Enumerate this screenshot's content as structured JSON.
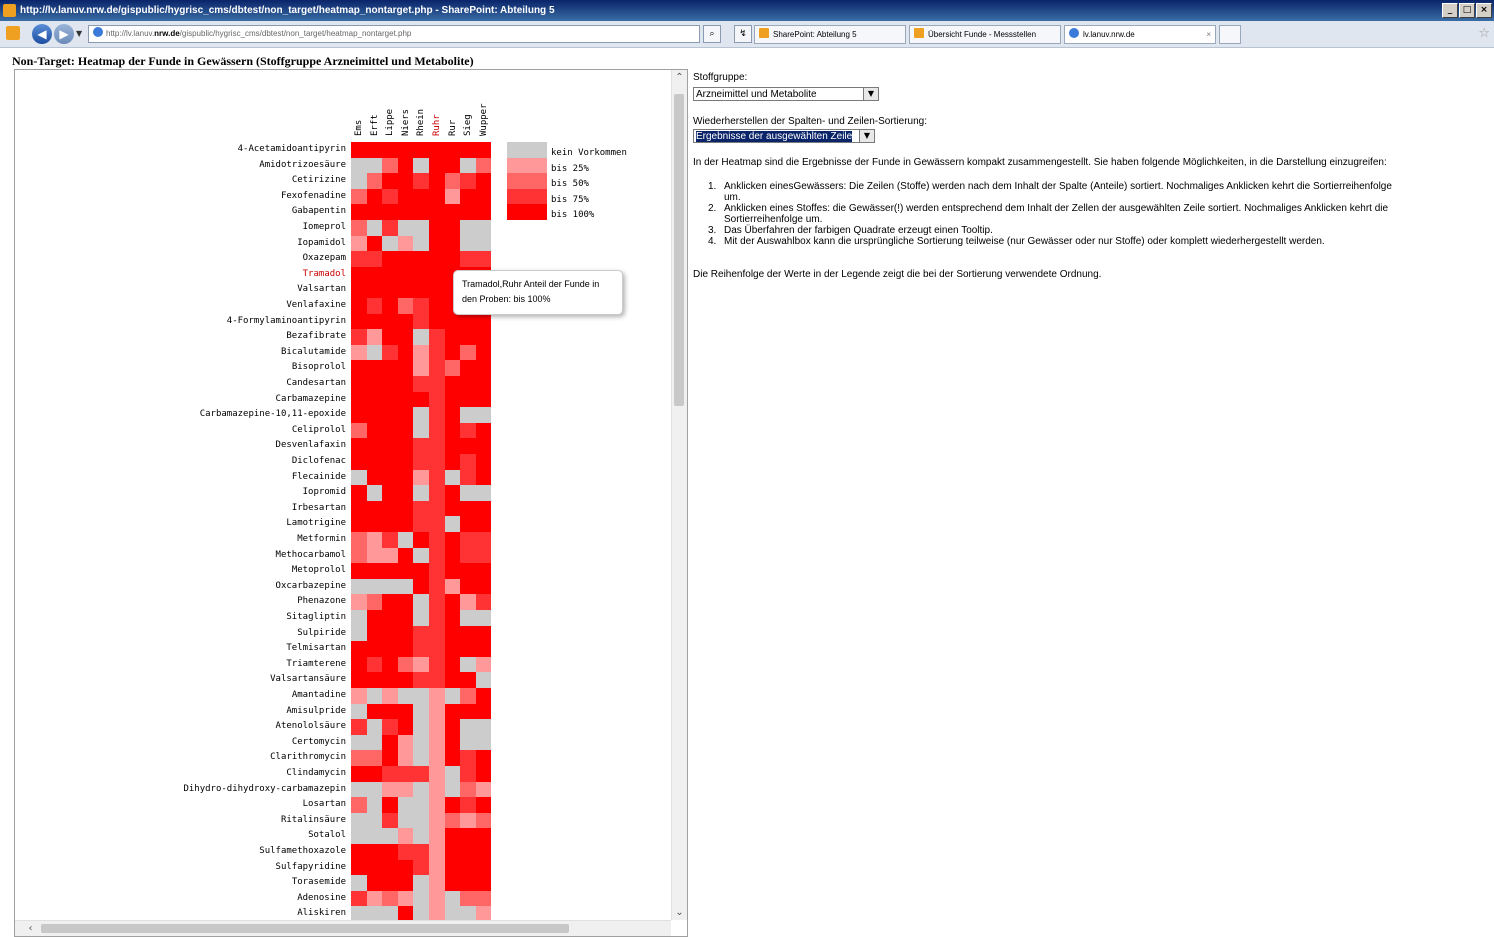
{
  "window": {
    "title": "http://lv.lanuv.nrw.de/gispublic/hygrisc_cms/dbtest/non_target/heatmap_nontarget.php - SharePoint: Abteilung 5"
  },
  "browser": {
    "address_prefix": "http://lv.lanuv.",
    "address_domain": "nrw.de",
    "address_path": "/gispublic/hygrisc_cms/dbtest/non_target/heatmap_nontarget.php",
    "tabs": [
      {
        "label": "SharePoint: Abteilung 5"
      },
      {
        "label": "Übersicht Funde - Messstellen"
      },
      {
        "label": "lv.lanuv.nrw.de"
      }
    ]
  },
  "page": {
    "title": "Non-Target: Heatmap der Funde in Gewässern (Stoffgruppe Arzneimittel und Metabolite)"
  },
  "heatmap": {
    "columns": [
      "Ems",
      "Erft",
      "Lippe",
      "Niers",
      "Rhein",
      "Ruhr",
      "Rur",
      "Sieg",
      "Wupper"
    ],
    "highlight_column": 5,
    "highlight_row": 8,
    "colors": [
      "#cccccc",
      "#ff9999",
      "#ff6666",
      "#ff3333",
      "#ff0000"
    ],
    "legend": [
      "kein Vorkommen",
      "bis 25%",
      "bis 50%",
      "bis 75%",
      "bis 100%"
    ],
    "rows": [
      {
        "name": "4-Acetamidoantipyrin",
        "v": [
          4,
          4,
          4,
          4,
          4,
          4,
          4,
          4,
          4
        ]
      },
      {
        "name": "Amidotrizoesäure",
        "v": [
          0,
          0,
          2,
          4,
          0,
          4,
          4,
          0,
          2
        ]
      },
      {
        "name": "Cetirizine",
        "v": [
          0,
          2,
          4,
          4,
          3,
          4,
          2,
          3,
          4
        ]
      },
      {
        "name": "Fexofenadine",
        "v": [
          2,
          4,
          3,
          4,
          4,
          4,
          1,
          4,
          4
        ]
      },
      {
        "name": "Gabapentin",
        "v": [
          4,
          4,
          4,
          4,
          4,
          4,
          4,
          4,
          4
        ]
      },
      {
        "name": "Iomeprol",
        "v": [
          2,
          0,
          3,
          0,
          0,
          4,
          4,
          0,
          0
        ]
      },
      {
        "name": "Iopamidol",
        "v": [
          1,
          4,
          0,
          1,
          0,
          4,
          4,
          0,
          0
        ]
      },
      {
        "name": "Oxazepam",
        "v": [
          3,
          3,
          4,
          4,
          4,
          4,
          4,
          3,
          3
        ]
      },
      {
        "name": "Tramadol",
        "v": [
          4,
          4,
          4,
          4,
          4,
          4,
          4,
          4,
          4
        ]
      },
      {
        "name": "Valsartan",
        "v": [
          4,
          4,
          4,
          4,
          4,
          4,
          4,
          4,
          4
        ]
      },
      {
        "name": "Venlafaxine",
        "v": [
          4,
          3,
          4,
          2,
          3,
          4,
          4,
          4,
          4
        ]
      },
      {
        "name": "4-Formylaminoantipyrin",
        "v": [
          4,
          4,
          4,
          4,
          3,
          4,
          4,
          4,
          4
        ]
      },
      {
        "name": "Bezafibrate",
        "v": [
          3,
          1,
          4,
          4,
          0,
          3,
          4,
          4,
          4
        ]
      },
      {
        "name": "Bicalutamide",
        "v": [
          1,
          0,
          3,
          4,
          1,
          3,
          4,
          2,
          4
        ]
      },
      {
        "name": "Bisoprolol",
        "v": [
          4,
          4,
          4,
          4,
          1,
          3,
          2,
          4,
          4
        ]
      },
      {
        "name": "Candesartan",
        "v": [
          4,
          4,
          4,
          4,
          3,
          3,
          4,
          4,
          4
        ]
      },
      {
        "name": "Carbamazepine",
        "v": [
          4,
          4,
          4,
          4,
          4,
          3,
          4,
          4,
          4
        ]
      },
      {
        "name": "Carbamazepine-10,11-epoxide",
        "v": [
          4,
          4,
          4,
          4,
          0,
          3,
          4,
          0,
          0
        ]
      },
      {
        "name": "Celiprolol",
        "v": [
          2,
          4,
          4,
          4,
          0,
          3,
          4,
          3,
          4
        ]
      },
      {
        "name": "Desvenlafaxin",
        "v": [
          4,
          4,
          4,
          4,
          3,
          3,
          4,
          4,
          4
        ]
      },
      {
        "name": "Diclofenac",
        "v": [
          4,
          4,
          4,
          4,
          3,
          3,
          4,
          3,
          4
        ]
      },
      {
        "name": "Flecainide",
        "v": [
          0,
          4,
          4,
          4,
          1,
          3,
          0,
          3,
          4
        ]
      },
      {
        "name": "Iopromid",
        "v": [
          4,
          0,
          4,
          4,
          0,
          3,
          4,
          0,
          0
        ]
      },
      {
        "name": "Irbesartan",
        "v": [
          4,
          4,
          4,
          4,
          3,
          3,
          4,
          4,
          4
        ]
      },
      {
        "name": "Lamotrigine",
        "v": [
          4,
          4,
          4,
          4,
          3,
          3,
          0,
          4,
          4
        ]
      },
      {
        "name": "Metformin",
        "v": [
          2,
          1,
          3,
          0,
          4,
          3,
          4,
          3,
          3
        ]
      },
      {
        "name": "Methocarbamol",
        "v": [
          2,
          1,
          1,
          4,
          0,
          3,
          4,
          3,
          3
        ]
      },
      {
        "name": "Metoprolol",
        "v": [
          4,
          4,
          4,
          4,
          4,
          3,
          4,
          4,
          4
        ]
      },
      {
        "name": "Oxcarbazepine",
        "v": [
          0,
          0,
          0,
          0,
          4,
          3,
          1,
          4,
          4
        ]
      },
      {
        "name": "Phenazone",
        "v": [
          1,
          2,
          4,
          4,
          0,
          3,
          4,
          1,
          3
        ]
      },
      {
        "name": "Sitagliptin",
        "v": [
          0,
          4,
          4,
          4,
          0,
          3,
          4,
          0,
          0
        ]
      },
      {
        "name": "Sulpiride",
        "v": [
          0,
          4,
          4,
          4,
          3,
          3,
          4,
          4,
          4
        ]
      },
      {
        "name": "Telmisartan",
        "v": [
          4,
          4,
          4,
          4,
          3,
          3,
          4,
          4,
          4
        ]
      },
      {
        "name": "Triamterene",
        "v": [
          4,
          3,
          4,
          2,
          1,
          3,
          4,
          0,
          1
        ]
      },
      {
        "name": "Valsartansäure",
        "v": [
          4,
          4,
          4,
          4,
          3,
          3,
          4,
          4,
          0
        ]
      },
      {
        "name": "Amantadine",
        "v": [
          1,
          0,
          1,
          0,
          0,
          1,
          0,
          2,
          4
        ]
      },
      {
        "name": "Amisulpride",
        "v": [
          0,
          4,
          4,
          4,
          0,
          1,
          4,
          4,
          4
        ]
      },
      {
        "name": "Atenololsäure",
        "v": [
          3,
          0,
          3,
          4,
          0,
          1,
          4,
          0,
          0
        ]
      },
      {
        "name": "Certomycin",
        "v": [
          0,
          0,
          4,
          1,
          0,
          1,
          4,
          0,
          0
        ]
      },
      {
        "name": "Clarithromycin",
        "v": [
          2,
          2,
          4,
          1,
          0,
          1,
          4,
          3,
          4
        ]
      },
      {
        "name": "Clindamycin",
        "v": [
          4,
          4,
          3,
          3,
          3,
          1,
          0,
          3,
          4
        ]
      },
      {
        "name": "Dihydro-dihydroxy-carbamazepin",
        "v": [
          0,
          0,
          1,
          1,
          0,
          1,
          0,
          2,
          1
        ]
      },
      {
        "name": "Losartan",
        "v": [
          2,
          0,
          4,
          0,
          0,
          1,
          4,
          3,
          4
        ]
      },
      {
        "name": "Ritalinsäure",
        "v": [
          0,
          0,
          3,
          0,
          0,
          1,
          2,
          1,
          2
        ]
      },
      {
        "name": "Sotalol",
        "v": [
          0,
          0,
          0,
          1,
          0,
          1,
          4,
          4,
          4
        ]
      },
      {
        "name": "Sulfamethoxazole",
        "v": [
          4,
          4,
          4,
          3,
          3,
          1,
          4,
          4,
          4
        ]
      },
      {
        "name": "Sulfapyridine",
        "v": [
          4,
          4,
          4,
          4,
          3,
          1,
          4,
          4,
          4
        ]
      },
      {
        "name": "Torasemide",
        "v": [
          0,
          4,
          4,
          4,
          0,
          1,
          4,
          4,
          4
        ]
      },
      {
        "name": "Adenosine",
        "v": [
          3,
          1,
          2,
          1,
          0,
          1,
          0,
          2,
          2
        ]
      },
      {
        "name": "Aliskiren",
        "v": [
          0,
          0,
          0,
          4,
          0,
          1,
          0,
          0,
          1
        ]
      }
    ]
  },
  "tooltip": {
    "line1": "Tramadol,Ruhr Anteil der Funde in",
    "line2": "den Proben: bis 100%"
  },
  "controls": {
    "stoffgruppe_label": "Stoffgruppe:",
    "stoffgruppe_value": "Arzneimittel und Metabolite",
    "restore_label": "Wiederherstellen der Spalten- und Zeilen-Sortierung:",
    "restore_value": "Ergebnisse der ausgewählten Zeile"
  },
  "info": {
    "intro": "In der Heatmap sind die Ergebnisse der Funde in Gewässern kompakt zusammengestellt. Sie haben folgende Möglichkeiten, in die Darstellung einzugreifen:",
    "steps": [
      {
        "num": "1.",
        "lines": [
          "Anklicken einesGewässers: Die Zeilen (Stoffe) werden nach dem Inhalt der Spalte (Anteile) sortiert. Nochmaliges Anklicken kehrt die Sortierreihenfolge",
          "um."
        ]
      },
      {
        "num": "2.",
        "lines": [
          "Anklicken eines Stoffes: die Gewässer(!) werden entsprechend dem Inhalt der Zellen der ausgewählten Zeile sortiert. Nochmaliges Anklicken kehrt die",
          "Sortierreihenfolge um."
        ]
      },
      {
        "num": "3.",
        "lines": [
          "Das Überfahren der farbigen Quadrate erzeugt einen Tooltip."
        ]
      },
      {
        "num": "4.",
        "lines": [
          "Mit der Auswahlbox kann die ursprüngliche Sortierung teilweise (nur Gewässer oder nur Stoffe) oder komplett wiederhergestellt werden."
        ]
      }
    ],
    "outro": "Die Reihenfolge der Werte in der Legende zeigt die bei der Sortierung verwendete Ordnung."
  }
}
